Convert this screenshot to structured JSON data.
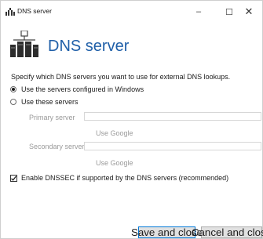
{
  "window": {
    "title": "DNS server",
    "minimize_glyph": "–",
    "maximize_glyph": "☐",
    "close_glyph": "✕",
    "icon": "dns-server-icon"
  },
  "header": {
    "title": "DNS server",
    "icon": "dns-server-large-icon",
    "accent_color": "#1f5fa8"
  },
  "description": "Specify which DNS servers you want to use for external DNS lookups.",
  "options": [
    {
      "label": "Use the servers configured in Windows",
      "selected": true
    },
    {
      "label": "Use these servers",
      "selected": false
    }
  ],
  "fields": {
    "primary_label": "Primary server",
    "primary_value": "",
    "secondary_label": "Secondary server",
    "secondary_value": "",
    "use_google_label": "Use Google"
  },
  "dnssec": {
    "label": "Enable DNSSEC if supported by the DNS servers (recommended)",
    "checked": true
  },
  "buttons": {
    "save": "Save and close",
    "cancel": "Cancel and close"
  }
}
